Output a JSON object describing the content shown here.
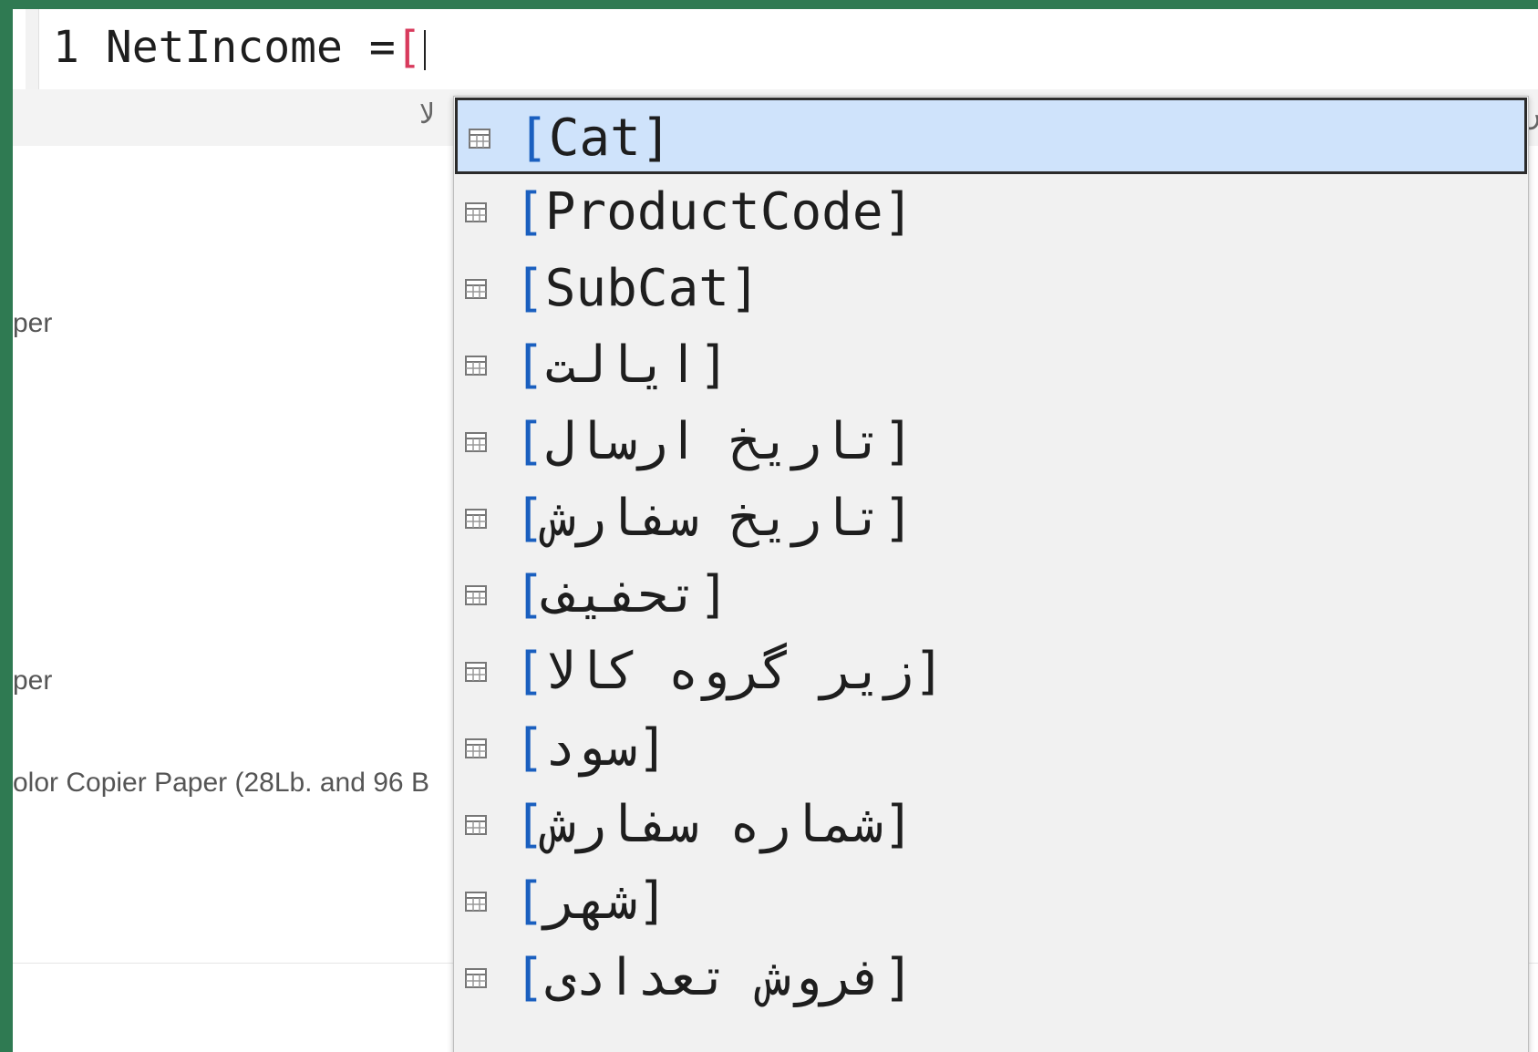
{
  "formula": {
    "line_number": "1",
    "measure_name": "NetIncome",
    "operator": "=",
    "open_bracket": "["
  },
  "grid": {
    "header_fragment_left": "لا",
    "header_fragment_right": "ش",
    "rows": [
      "",
      "",
      "",
      "per",
      "",
      "",
      "",
      "",
      "",
      "",
      "per",
      "",
      "olor Copier Paper (28Lb. and 96 B",
      "",
      "",
      ""
    ]
  },
  "autocomplete": {
    "items": [
      {
        "label": "Cat",
        "selected": true
      },
      {
        "label": "ProductCode",
        "selected": false
      },
      {
        "label": "SubCat",
        "selected": false
      },
      {
        "label": "ایالت",
        "selected": false
      },
      {
        "label": "تاریخ ارسال",
        "selected": false
      },
      {
        "label": "تاریخ سفارش",
        "selected": false
      },
      {
        "label": "تحفیف",
        "selected": false
      },
      {
        "label": "زیر گروه کالا",
        "selected": false
      },
      {
        "label": "سود",
        "selected": false
      },
      {
        "label": "شماره سفارش",
        "selected": false
      },
      {
        "label": "شهر",
        "selected": false
      },
      {
        "label": "فروش تعدادی",
        "selected": false
      }
    ],
    "item_icon": "table-column-icon",
    "bracket_open": "[",
    "bracket_close": "]"
  },
  "colors": {
    "frame": "#2f7a52",
    "selection": "#cfe3fb",
    "bracket": "#1a5fbf",
    "formula_bracket": "#d83a5c"
  }
}
